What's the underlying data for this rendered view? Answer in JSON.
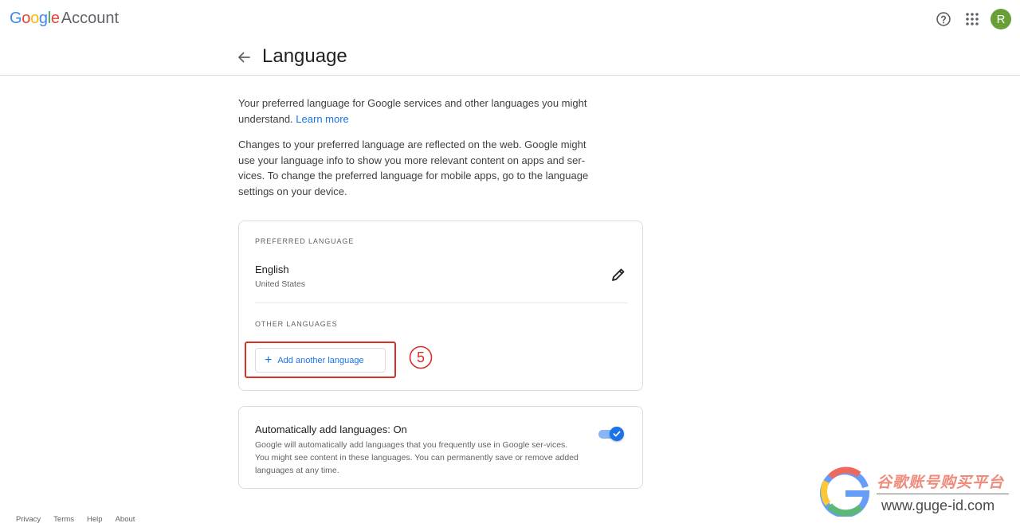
{
  "topbar": {
    "logo_letters": [
      "G",
      "o",
      "o",
      "g",
      "l",
      "e"
    ],
    "logo_account": "Account",
    "help_icon": "help-circle-icon",
    "apps_icon": "apps-grid-icon",
    "avatar_initial": "R",
    "avatar_color": "#689f38"
  },
  "header": {
    "back_icon": "arrow-back-icon",
    "title": "Language"
  },
  "intro": {
    "p1_text": "Your preferred language for Google services and other languages you might understand.",
    "p1_link": "Learn more",
    "p2_text": "Changes to your preferred language are reflected on the web. Google might use your language info to show you more relevant content on apps and ser-vices. To change the preferred language for mobile apps, go to the language settings on your device."
  },
  "preferred": {
    "label": "PREFERRED LANGUAGE",
    "language": "English",
    "region": "United States",
    "edit_icon": "pencil-icon"
  },
  "other": {
    "label": "OTHER LANGUAGES",
    "add_label": "Add another language",
    "plus_glyph": "+",
    "step_marker": "5"
  },
  "auto_add": {
    "title": "Automatically add languages: On",
    "description": "Google will automatically add languages that you frequently use in Google ser-vices. You might see content in these languages. You can permanently save or remove added languages at any time.",
    "toggle_on": true
  },
  "footer": {
    "links": [
      "Privacy",
      "Terms",
      "Help",
      "About"
    ]
  },
  "watermark": {
    "cn_text": "谷歌账号购买平台",
    "url": "www.guge-id.com"
  },
  "colors": {
    "accent": "#1a73e8",
    "highlight": "#d93025"
  }
}
